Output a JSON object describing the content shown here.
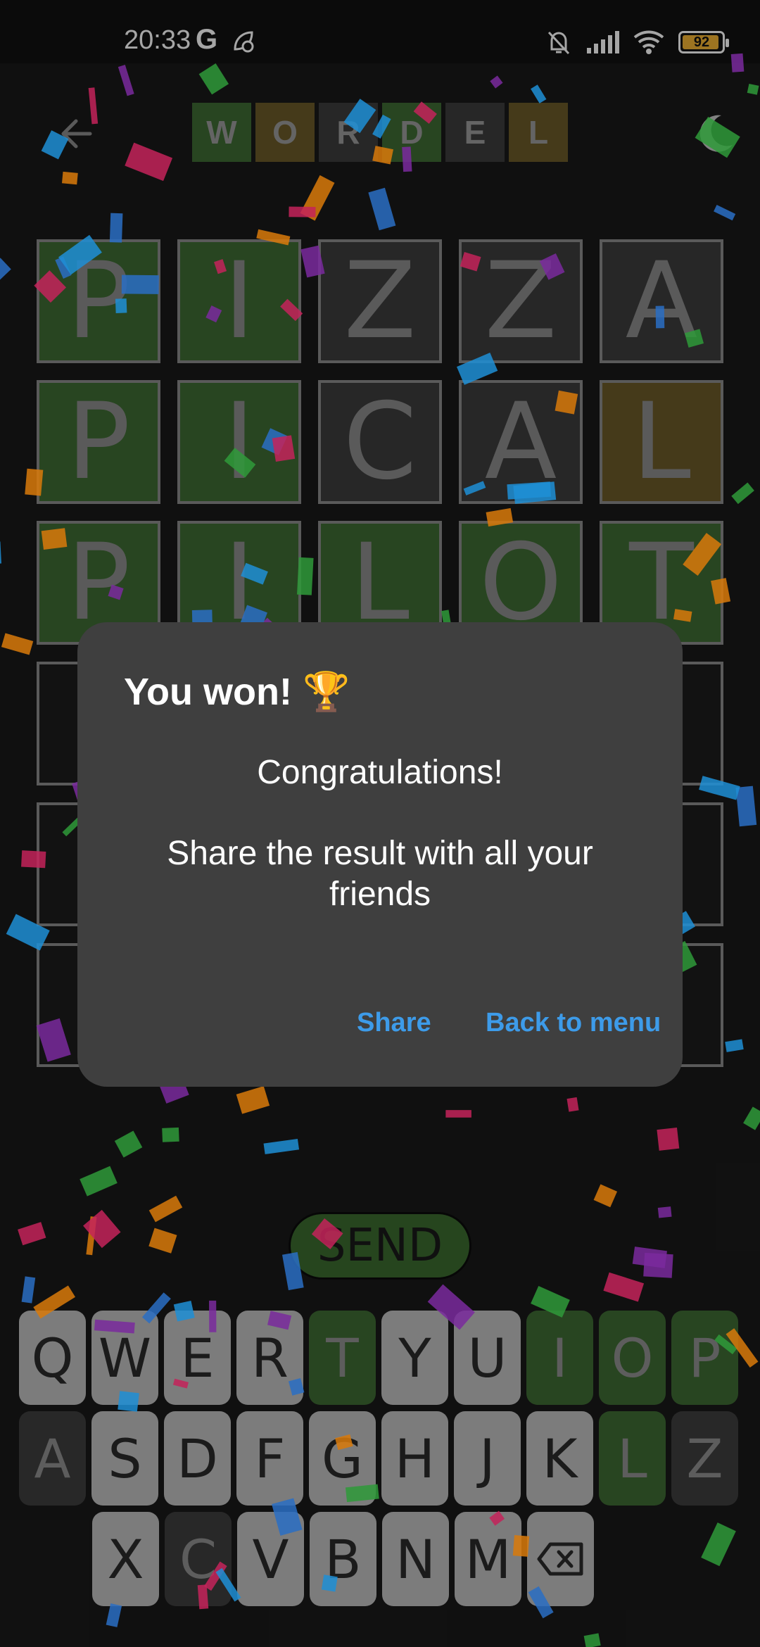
{
  "status_bar": {
    "time": "20:33",
    "carrier_glyph": "G",
    "battery": "92"
  },
  "header": {
    "title_letters": [
      {
        "letter": "W",
        "color": "#3e6b34"
      },
      {
        "letter": "O",
        "color": "#6a5a28"
      },
      {
        "letter": "R",
        "color": "#3c3c3c"
      },
      {
        "letter": "D",
        "color": "#3e6b34"
      },
      {
        "letter": "E",
        "color": "#3c3c3c"
      },
      {
        "letter": "L",
        "color": "#6a5a28"
      }
    ],
    "back_icon": "arrow-back-icon",
    "theme_icon": "moon-icon"
  },
  "board": {
    "rows": [
      [
        {
          "l": "P",
          "s": "green"
        },
        {
          "l": "I",
          "s": "green"
        },
        {
          "l": "Z",
          "s": "gray"
        },
        {
          "l": "Z",
          "s": "gray"
        },
        {
          "l": "A",
          "s": "gray"
        }
      ],
      [
        {
          "l": "P",
          "s": "green"
        },
        {
          "l": "I",
          "s": "green"
        },
        {
          "l": "C",
          "s": "gray"
        },
        {
          "l": "A",
          "s": "gray"
        },
        {
          "l": "L",
          "s": "yellow"
        }
      ],
      [
        {
          "l": "P",
          "s": "green"
        },
        {
          "l": "I",
          "s": "green"
        },
        {
          "l": "L",
          "s": "green"
        },
        {
          "l": "O",
          "s": "green"
        },
        {
          "l": "T",
          "s": "green"
        }
      ],
      [
        {
          "l": "",
          "s": "empty"
        },
        {
          "l": "",
          "s": "empty"
        },
        {
          "l": "",
          "s": "empty"
        },
        {
          "l": "",
          "s": "empty"
        },
        {
          "l": "",
          "s": "empty"
        }
      ],
      [
        {
          "l": "",
          "s": "empty"
        },
        {
          "l": "",
          "s": "empty"
        },
        {
          "l": "",
          "s": "empty"
        },
        {
          "l": "",
          "s": "empty"
        },
        {
          "l": "",
          "s": "empty"
        }
      ],
      [
        {
          "l": "",
          "s": "empty"
        },
        {
          "l": "",
          "s": "empty"
        },
        {
          "l": "",
          "s": "empty"
        },
        {
          "l": "",
          "s": "empty"
        },
        {
          "l": "",
          "s": "empty"
        }
      ]
    ]
  },
  "send_label": "SEND",
  "keyboard": {
    "rows": [
      [
        {
          "k": "Q",
          "s": "default"
        },
        {
          "k": "W",
          "s": "default"
        },
        {
          "k": "E",
          "s": "default"
        },
        {
          "k": "R",
          "s": "default"
        },
        {
          "k": "T",
          "s": "green"
        },
        {
          "k": "Y",
          "s": "default"
        },
        {
          "k": "U",
          "s": "default"
        },
        {
          "k": "I",
          "s": "green"
        },
        {
          "k": "O",
          "s": "green"
        },
        {
          "k": "P",
          "s": "green"
        }
      ],
      [
        {
          "k": "A",
          "s": "gray"
        },
        {
          "k": "S",
          "s": "default"
        },
        {
          "k": "D",
          "s": "default"
        },
        {
          "k": "F",
          "s": "default"
        },
        {
          "k": "G",
          "s": "default"
        },
        {
          "k": "H",
          "s": "default"
        },
        {
          "k": "J",
          "s": "default"
        },
        {
          "k": "K",
          "s": "default"
        },
        {
          "k": "L",
          "s": "green"
        },
        {
          "k": "Z",
          "s": "gray"
        }
      ],
      [
        {
          "k": "X",
          "s": "default"
        },
        {
          "k": "C",
          "s": "gray"
        },
        {
          "k": "V",
          "s": "default"
        },
        {
          "k": "B",
          "s": "default"
        },
        {
          "k": "N",
          "s": "default"
        },
        {
          "k": "M",
          "s": "default"
        },
        {
          "k": "backspace-icon",
          "s": "default"
        }
      ]
    ]
  },
  "dialog": {
    "title": "You won! 🏆",
    "message": "Congratulations!",
    "detail": "Share the result with all your friends",
    "share_label": "Share",
    "menu_label": "Back to menu"
  }
}
